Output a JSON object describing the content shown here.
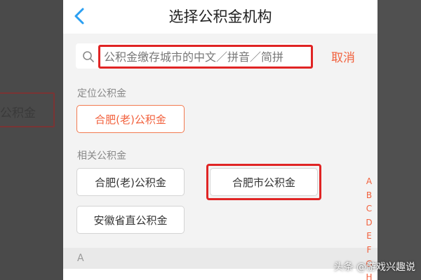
{
  "header": {
    "title": "选择公积金机构"
  },
  "search": {
    "placeholder": "公积金缴存城市的中文／拼音／简拼",
    "cancel_label": "取消"
  },
  "located": {
    "section_label": "定位公积金",
    "item_label": "合肥(老)公积金"
  },
  "related": {
    "section_label": "相关公积金",
    "items": [
      {
        "label": "合肥(老)公积金"
      },
      {
        "label": "合肥市公积金"
      },
      {
        "label": "安徽省直公积金"
      }
    ]
  },
  "list": {
    "first_index_header": "A"
  },
  "alphabet_index": [
    "A",
    "B",
    "C",
    "D",
    "E",
    "F",
    "G",
    "H"
  ],
  "background": {
    "ghost_text": "公积金"
  },
  "watermark": {
    "text": "头条 @游戏兴趣说"
  },
  "colors": {
    "accent": "#f2613d",
    "highlight_red": "#e02424",
    "page_bg": "#f3f3f3",
    "back_arrow": "#2a9ff2"
  }
}
